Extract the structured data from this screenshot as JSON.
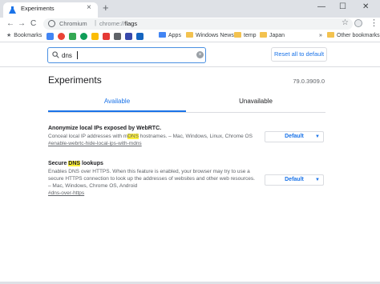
{
  "tab": {
    "title": "Experiments",
    "close": "×"
  },
  "new_tab": "+",
  "window": {
    "minimize": "—",
    "maximize": "☐",
    "close": "✕"
  },
  "toolbar": {
    "back": "←",
    "forward": "→",
    "reload": "C",
    "star": "☆",
    "menu": "⋮"
  },
  "omnibox": {
    "site": "Chromium",
    "separator": "|",
    "scheme": "chrome://",
    "path": "flags"
  },
  "bookmarks": {
    "bookmarks_label": "Bookmarks",
    "apps": "Apps",
    "windows_news": "Windows News",
    "temp": "temp",
    "japan": "Japan",
    "other": "Other bookmarks",
    "more": "»"
  },
  "search": {
    "value": "dns",
    "clear": "×"
  },
  "reset_label": "Reset all to default",
  "page_title": "Experiments",
  "version": "79.0.3909.0",
  "tabs": {
    "available": "Available",
    "unavailable": "Unavailable"
  },
  "experiments": [
    {
      "title": "Anonymize local IPs exposed by WebRTC.",
      "desc_before": "Conceal local IP addresses with m",
      "desc_highlight": "DNS",
      "desc_after": " hostnames. – Mac, Windows, Linux, Chrome OS",
      "link": "#enable-webrtc-hide-local-ips-with-mdns",
      "select": "Default"
    },
    {
      "title_before": "Secure ",
      "title_highlight": "DNS",
      "title_after": " lookups",
      "desc": "Enables DNS over HTTPS. When this feature is enabled, your browser may try to use a secure HTTPS connection to look up the addresses of websites and other web resources. – Mac, Windows, Chrome OS, Android",
      "link": "#dns-over-https",
      "select": "Default"
    }
  ],
  "colors": {
    "accent": "#1a73e8",
    "highlight": "#fff13c",
    "chrome_frame": "#dee1e6",
    "search_border": "#4a90e2"
  }
}
